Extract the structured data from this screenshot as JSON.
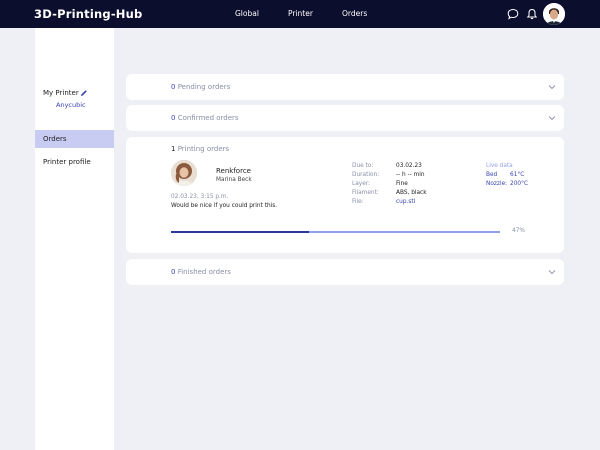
{
  "app": {
    "brand": "3D-Printing-Hub",
    "nav": {
      "global": "Global",
      "printer": "Printer",
      "orders": "Orders"
    },
    "icons": {
      "chat": "chat-icon",
      "bell": "bell-icon"
    }
  },
  "sidebar": {
    "my_printer_label": "My Printer",
    "printer_name": "Anycubic",
    "items": [
      {
        "label": "Orders",
        "active": true
      },
      {
        "label": "Printer profile",
        "active": false
      }
    ]
  },
  "sections": {
    "pending": {
      "count": "0",
      "label": "Pending orders"
    },
    "confirmed": {
      "count": "0",
      "label": "Confirmed orders"
    },
    "printing": {
      "count": "1",
      "label": "Printing orders"
    },
    "finished": {
      "count": "0",
      "label": "Finished orders"
    }
  },
  "order": {
    "company": "Renkforce",
    "customer": "Marina Beck",
    "date": "02.03.23, 3:15 p.m.",
    "note": "Would be nice if you could print this.",
    "details": {
      "due_label": "Due to:",
      "due_value": "03.02.23",
      "duration_label": "Duration:",
      "duration_value": "-- h -- min",
      "layer_label": "Layer:",
      "layer_value": "Fine",
      "filament_label": "Filament:",
      "filament_value": "ABS, black",
      "file_label": "File:",
      "file_value": "cup.stl"
    },
    "live": {
      "title": "Live data",
      "bed_label": "Bed",
      "bed_value": "61°C",
      "nozzle_label": "Nozzle:",
      "nozzle_value": "200°C"
    },
    "progress_fraction": 0.42,
    "progress_text": "47%"
  },
  "colors": {
    "topbar": "#0c0e2e",
    "accent": "#3b45b0",
    "active_item": "#c8ccf2",
    "progress": "#2a3a9a"
  }
}
